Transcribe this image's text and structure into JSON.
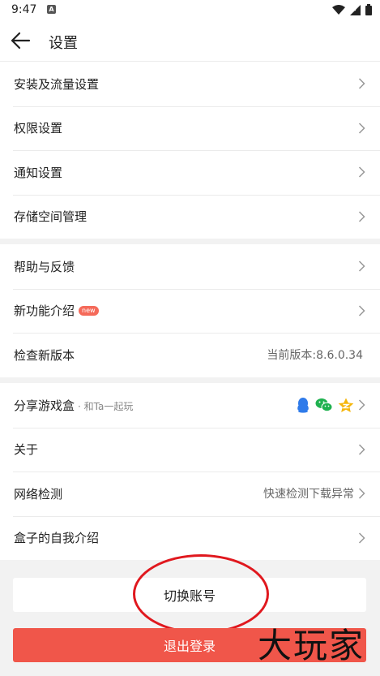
{
  "status_bar": {
    "time": "9:47",
    "badge": "A"
  },
  "header": {
    "title": "设置"
  },
  "groups": [
    {
      "rows": [
        {
          "label": "安装及流量设置"
        },
        {
          "label": "权限设置"
        },
        {
          "label": "通知设置"
        },
        {
          "label": "存储空间管理"
        }
      ]
    },
    {
      "rows": [
        {
          "label": "帮助与反馈"
        },
        {
          "label": "新功能介绍",
          "badge": "new"
        },
        {
          "label": "检查新版本",
          "value": "当前版本:8.6.0.34"
        }
      ]
    },
    {
      "rows": [
        {
          "label": "分享游戏盒",
          "sub": "· 和Ta一起玩",
          "share_icons": [
            "qq-icon",
            "wechat-icon",
            "qzone-icon"
          ]
        },
        {
          "label": "关于"
        },
        {
          "label": "网络检测",
          "value": "快速检测下载异常"
        },
        {
          "label": "盒子的自我介绍"
        }
      ]
    }
  ],
  "buttons": {
    "switch_account": "切换账号",
    "logout": "退出登录"
  },
  "watermark": "大玩家",
  "colors": {
    "logout_bg": "#f0564a",
    "annotation": "#e0181e",
    "badge_bg": "#f56a5a"
  }
}
